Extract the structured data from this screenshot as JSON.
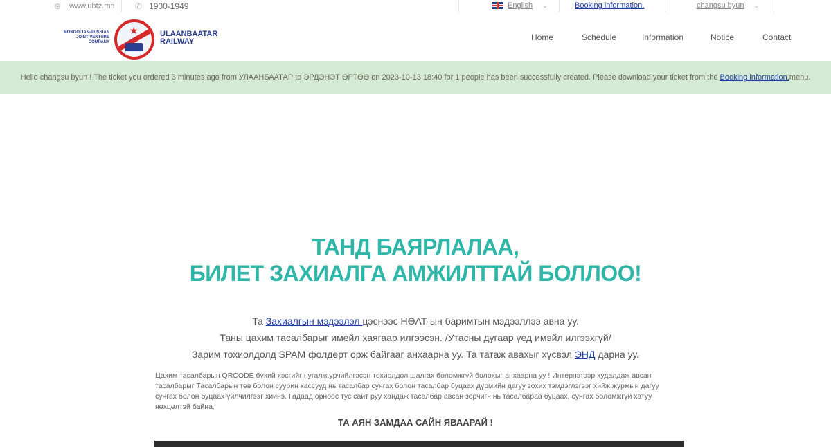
{
  "topbar": {
    "website": "www.ubtz.mn",
    "phone": "1900-1949",
    "language": "English",
    "booking_link": "Booking information.",
    "user": "changsu byun"
  },
  "logo": {
    "left_text": "MONGOLIAN-RUSSIAN JOINT VENTURE COMPANY",
    "right_line1": "ULAANBAATAR",
    "right_line2": "RAILWAY"
  },
  "nav": {
    "home": "Home",
    "schedule": "Schedule",
    "information": "Information",
    "notice": "Notice",
    "contact": "Contact"
  },
  "notice": {
    "text": "Hello changsu byun ! The ticket you ordered 3 minutes ago from УЛААНБААТАР to ЭРДЭНЭТ ӨРТӨӨ on 2023-10-13 18:40 for 1 people has been successfully created. Please download your ticket from the",
    "link": "Booking information.",
    "suffix": " menu."
  },
  "main": {
    "title_line1": "ТАНД БАЯРЛАЛАА,",
    "title_line2": "БИЛЕТ ЗАХИАЛГА АМЖИЛТТАЙ БОЛЛОО!",
    "line1_prefix": "Та ",
    "line1_link": "Захиалгын мэдээлэл ",
    "line1_suffix": "цэснээс НӨАТ-ын баримтын мэдээллээ авна уу.",
    "line2": "Таны цахим тасалбарыг имейл хаягаар илгээсэн. /Утасны дугаар үед имэйл илгээхгүй/",
    "line3_prefix": "Зарим тохиолдолд SPAM фолдерт орж байгааг анхаарна уу. Та татаж авахыг хүсвэл ",
    "line3_link": "ЭНД",
    "line3_suffix": " дарна уу.",
    "small_text": "Цахим тасалбарын QRCODE бүхий хэсгийг нугалж,урчийлгэсэн тохиолдол шалгах боломжгүй болохыг анхаарна уу ! Интернэтээр худалдаж авсан тасалбарыг Тасалбарын төв болон суурин кассууд нь тасалбар сунгах болон тасалбар буцаах дүрмийн дагуу зохих тэмдэглэгээг хийж журмын дагуу сунгах болон буцаах үйлчилгээг хийнэ. Гадаад орноос тус сайт руу хандаж тасалбар авсан зорчигч нь тасалбараа буцаах, сунгах боломжгүй хатуу нөхцөлтэй байна.",
    "goodbye": "ТА АЯН ЗАМДАА САЙН ЯВААРАЙ !"
  },
  "colors": {
    "accent": "#2fb6a8",
    "notice_bg": "#d4ead4",
    "link": "#1d3fa0",
    "brand": "#2a3f8f",
    "brand_red": "#d62a2a"
  }
}
